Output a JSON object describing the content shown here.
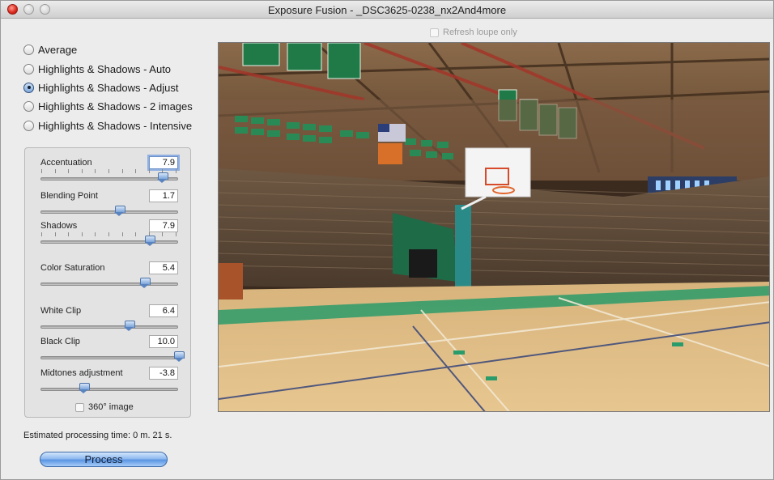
{
  "window": {
    "title": "Exposure Fusion - _DSC3625-0238_nx2And4more"
  },
  "preview": {
    "refresh_loupe_label": "Refresh loupe only",
    "refresh_loupe_checked": false,
    "image_label": "photo-gymnasium-basketball-court"
  },
  "modes": [
    {
      "label": "Average",
      "selected": false
    },
    {
      "label": "Highlights & Shadows - Auto",
      "selected": false
    },
    {
      "label": "Highlights & Shadows - Adjust",
      "selected": true
    },
    {
      "label": "Highlights & Shadows - 2 images",
      "selected": false
    },
    {
      "label": "Highlights & Shadows - Intensive",
      "selected": false
    }
  ],
  "sliders": [
    {
      "label": "Accentuation",
      "value": "7.9",
      "fraction": 0.88
    },
    {
      "label": "Blending Point",
      "value": "1.7",
      "fraction": 0.57
    },
    {
      "label": "Shadows",
      "value": "7.9",
      "fraction": 0.79
    },
    {
      "label": "Color Saturation",
      "value": "5.4",
      "fraction": 0.75
    },
    {
      "label": "White Clip",
      "value": "6.4",
      "fraction": 0.64
    },
    {
      "label": "Black Clip",
      "value": "10.0",
      "fraction": 1.0
    },
    {
      "label": "Midtones adjustment",
      "value": "-3.8",
      "fraction": 0.31
    }
  ],
  "options": {
    "image_360_label": "360° image",
    "image_360_checked": false
  },
  "status": {
    "estimated_time": "Estimated processing time: 0 m. 21 s."
  },
  "actions": {
    "process_label": "Process"
  }
}
